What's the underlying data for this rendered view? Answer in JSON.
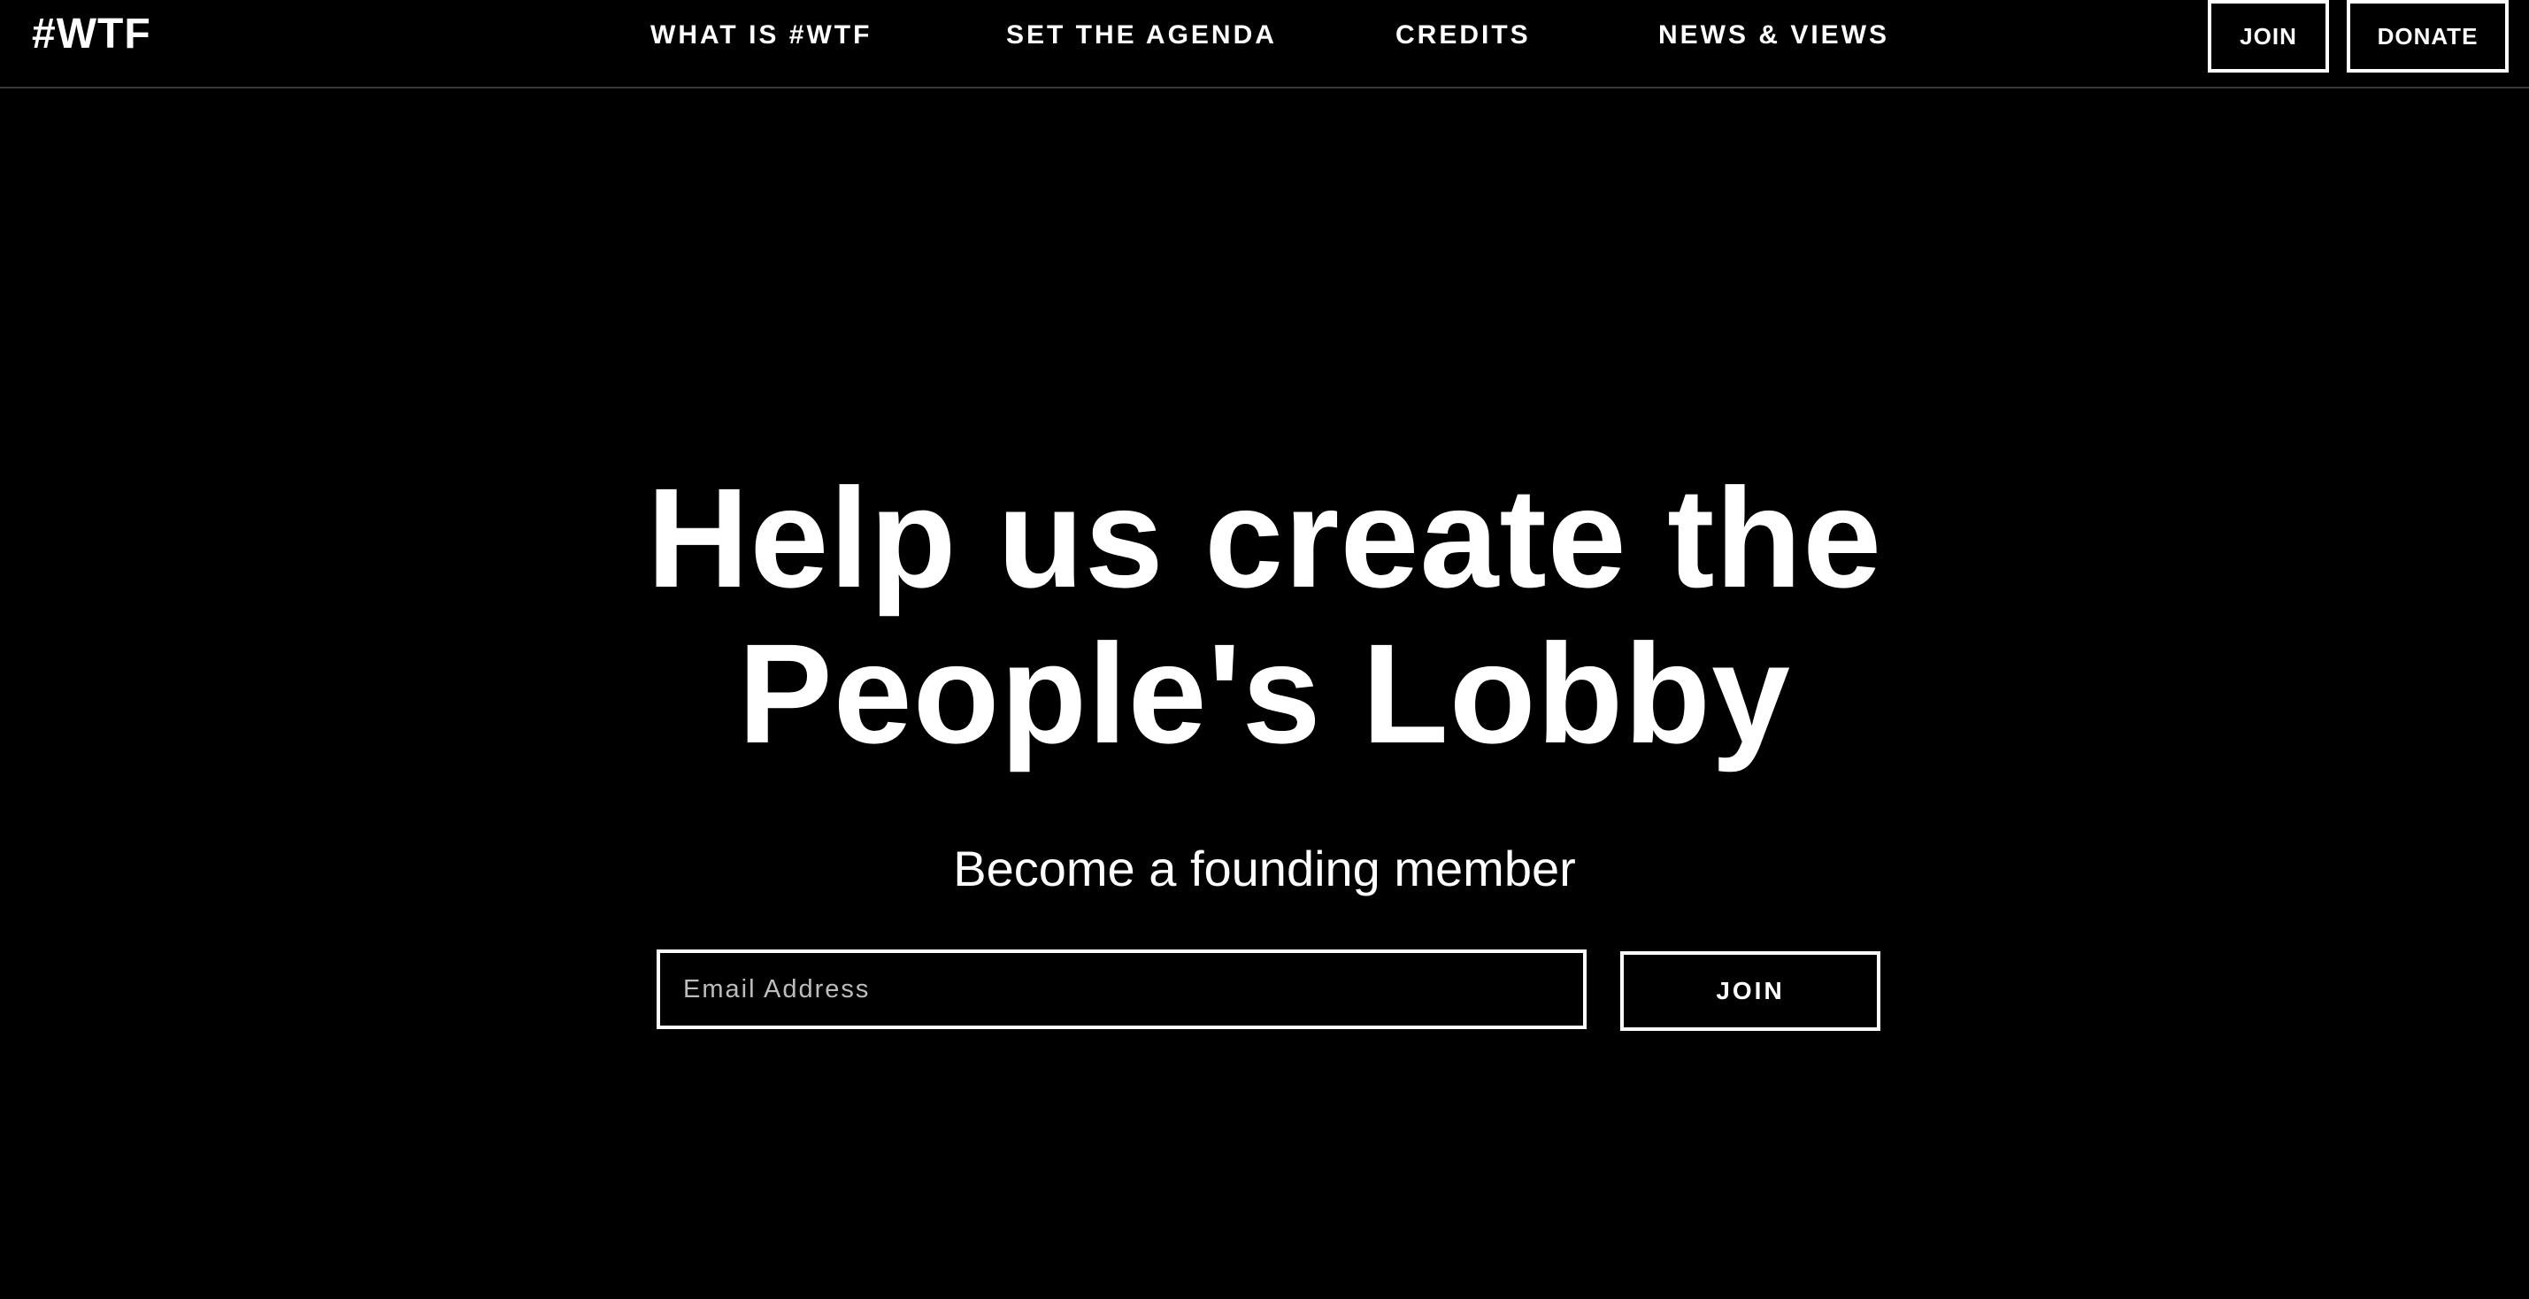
{
  "header": {
    "logo": "#WTF",
    "nav": [
      {
        "label": "WHAT IS #WTF"
      },
      {
        "label": "SET THE AGENDA"
      },
      {
        "label": "CREDITS"
      },
      {
        "label": "NEWS & VIEWS"
      }
    ],
    "join_label": "JOIN",
    "donate_label": "DONATE"
  },
  "hero": {
    "title_line1": "Help us create the",
    "title_line2": "People's Lobby",
    "subtitle": "Become a founding member"
  },
  "signup": {
    "email_placeholder": "Email Address",
    "join_label": "JOIN"
  },
  "colors": {
    "background": "#000000",
    "foreground": "#ffffff",
    "divider": "#3a3a3a"
  }
}
